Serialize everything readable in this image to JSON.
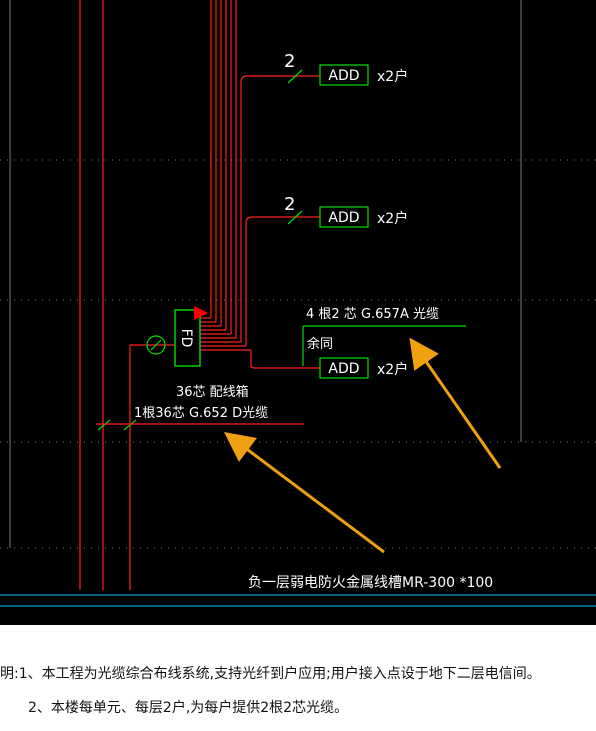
{
  "colors": {
    "background": "#000000",
    "wire": "#ff2020",
    "green": "#00e000",
    "cyan": "#00c8ff",
    "grid": "#7a7a7a",
    "text": "#ffffff",
    "arrow": "#f0a010",
    "flag": "#ff0000"
  },
  "diagram": {
    "branch_top": {
      "count": "2",
      "box": "ADD",
      "suffix": "x2户"
    },
    "branch_mid": {
      "count": "2",
      "box": "ADD",
      "suffix": "x2户"
    },
    "branch_low": {
      "box": "ADD",
      "suffix": "x2户"
    },
    "cable_spec": "4 根2 芯  G.657A     光缆",
    "spare": "余同",
    "fd_box": "FD",
    "fd_label": "36芯   配线箱",
    "riser_cable": "1根36芯 G.652 D光缆",
    "tray": "负一层弱电防火金属线槽MR-300 *100"
  },
  "notes": {
    "line1": "明:1、本工程为光缆综合布线系统,支持光纤到户应用;用户接入点设于地下二层电信间。",
    "line2": "2、本楼每单元、每层2户,为每户提供2根2芯光缆。"
  }
}
